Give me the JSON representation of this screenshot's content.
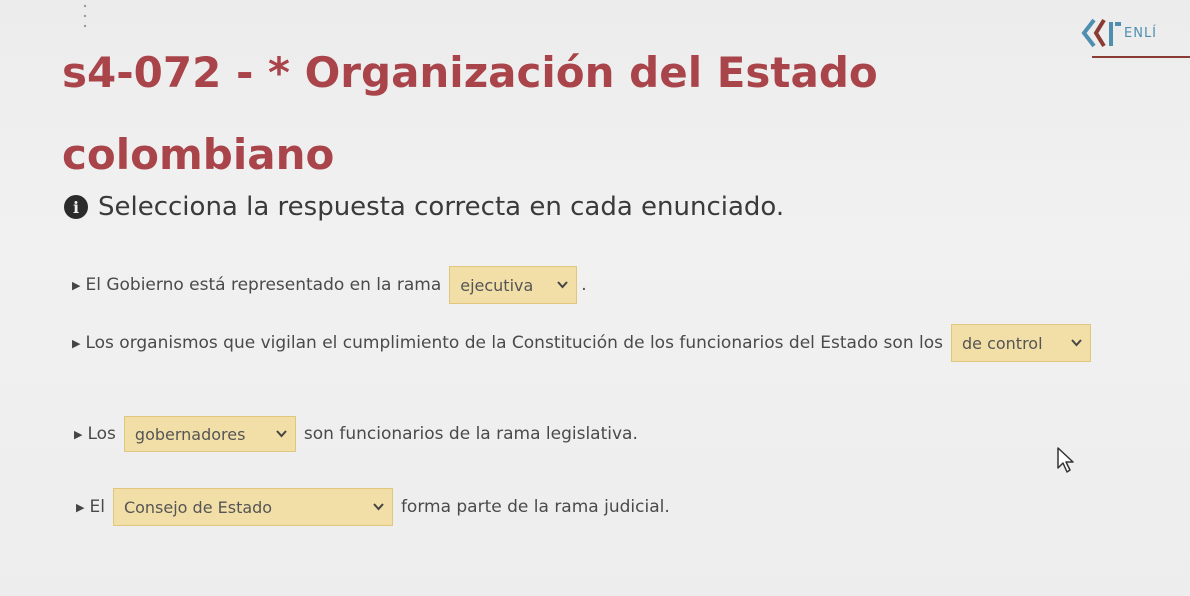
{
  "logo": {
    "text": "ENLÍ",
    "icon": "enlinea-logo-icon"
  },
  "title": "s4-072 - * Organización del Estado colombiano",
  "instruction": {
    "icon": "info-icon",
    "text": "Selecciona la respuesta correcta en cada enunciado."
  },
  "questions": [
    {
      "before": "El Gobierno está representado en la rama",
      "selected": "ejecutiva",
      "after": "."
    },
    {
      "before": "Los organismos que vigilan el cumplimiento de la Constitución de los funcionarios del Estado son los",
      "selected": "de control",
      "after": ""
    },
    {
      "before": "Los",
      "selected": "gobernadores",
      "after": "son funcionarios de la rama legislativa."
    },
    {
      "before": "El",
      "selected": "Consejo de Estado",
      "after": "forma parte de la rama judicial."
    }
  ],
  "colors": {
    "title": "#a9454a",
    "select_bg": "#f2dfa7",
    "select_border": "#e1c77e",
    "logo_text": "#4e8fb0",
    "logo_line": "#8a3b33"
  }
}
